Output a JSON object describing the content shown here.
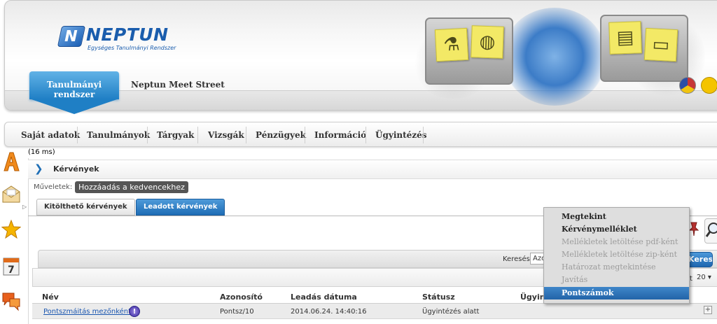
{
  "brand": {
    "name": "NEPTUN",
    "tagline": "Egységes Tanulmányi Rendszer"
  },
  "system_tabs": {
    "active": "Tanulmányi rendszer",
    "other": "Neptun Meet Street"
  },
  "main_menu": [
    "Saját adatok",
    "Tanulmányok",
    "Tárgyak",
    "Vizsgák",
    "Pénzügyek",
    "Információ",
    "Ügyintézés"
  ],
  "timing": "(16 ms)",
  "panel": {
    "title": "Kérvények",
    "operations_label": "Műveletek:",
    "favorite_button": "Hozzáadás a kedvencekhez"
  },
  "subtabs": {
    "fillable": "Kitölthető kérvények",
    "submitted": "Leadott kérvények"
  },
  "search": {
    "label": "Keresés",
    "field_value": "Azo",
    "button": "Keresés"
  },
  "pager": {
    "label": "t",
    "page_size": "20"
  },
  "table": {
    "columns": [
      "Név",
      "Azonosító",
      "Leadás dátuma",
      "Státusz",
      "Ügyint"
    ],
    "rows": [
      {
        "name": "Pontszmáitás mezőnként",
        "id": "Pontsz/10",
        "date": "2014.06.24. 14:40:16",
        "status": "Ügyintézés alatt"
      }
    ]
  },
  "context_menu": {
    "items": [
      {
        "label": "Megtekint",
        "state": "enabled"
      },
      {
        "label": "Kérvénymelléklet",
        "state": "enabled"
      },
      {
        "label": "Mellékletek letöltése pdf-ként",
        "state": "disabled"
      },
      {
        "label": "Mellékletek letöltése zip-ként",
        "state": "disabled"
      },
      {
        "label": "Határozat megtekintése",
        "state": "disabled"
      },
      {
        "label": "Javítás",
        "state": "disabled"
      },
      {
        "label": "Pontszámok",
        "state": "highlighted"
      }
    ]
  },
  "colors": {
    "accent": "#1f7fc5",
    "highlight": "#2264a8",
    "brand": "#1a5dad"
  },
  "sidebar_icons": [
    "letter-a-icon",
    "envelope-icon",
    "star-icon",
    "calendar-icon",
    "chat-bubble-icon"
  ]
}
